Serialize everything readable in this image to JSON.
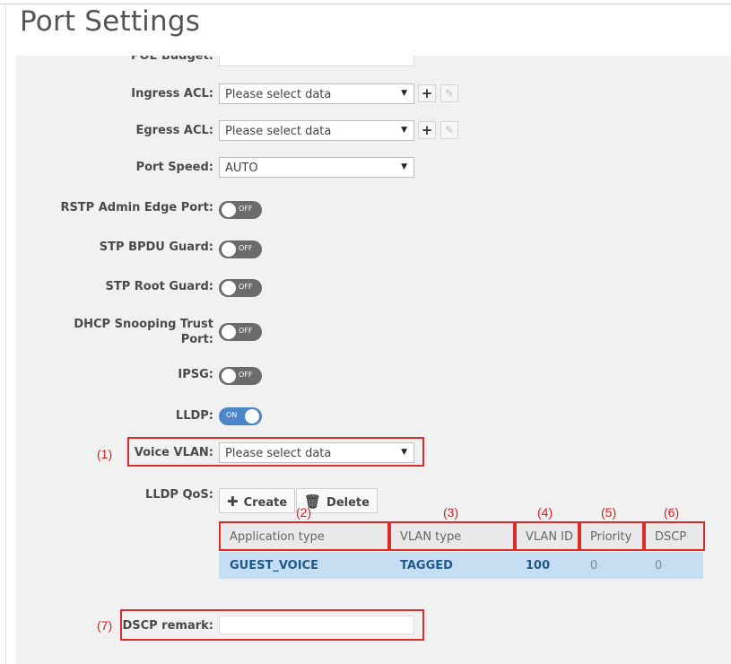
{
  "page": {
    "title": "Port Settings"
  },
  "form": {
    "poe_budget_label": "POE Budget:",
    "ingress_acl": {
      "label": "Ingress ACL:",
      "value": "Please select data",
      "add_icon": "plus-icon",
      "edit_icon": "pencil-icon"
    },
    "egress_acl": {
      "label": "Egress ACL:",
      "value": "Please select data",
      "add_icon": "plus-icon",
      "edit_icon": "pencil-icon"
    },
    "port_speed": {
      "label": "Port Speed:",
      "value": "AUTO"
    },
    "rstp_admin_edge_port": {
      "label": "RSTP Admin Edge Port:",
      "state": "OFF"
    },
    "stp_bpdu_guard": {
      "label": "STP BPDU Guard:",
      "state": "OFF"
    },
    "stp_root_guard": {
      "label": "STP Root Guard:",
      "state": "OFF"
    },
    "dhcp_snooping_trust_port": {
      "label_line1": "DHCP Snooping Trust",
      "label_line2": "Port:",
      "state": "OFF"
    },
    "ipsg": {
      "label": "IPSG:",
      "state": "OFF"
    },
    "lldp": {
      "label": "LLDP:",
      "state": "ON"
    },
    "voice_vlan": {
      "label": "Voice VLAN:",
      "value": "Please select data"
    },
    "lldp_qos": {
      "label": "LLDP QoS:",
      "create_label": "Create",
      "delete_label": "Delete",
      "columns": [
        "Application type",
        "VLAN type",
        "VLAN ID",
        "Priority",
        "DSCP"
      ],
      "rows": [
        {
          "application_type": "GUEST_VOICE",
          "vlan_type": "TAGGED",
          "vlan_id": "100",
          "priority": "0",
          "dscp": "0"
        }
      ]
    },
    "dscp_remark": {
      "label": "DSCP remark:",
      "value": ""
    }
  },
  "annotations": {
    "voice_vlan": "(1)",
    "application_type": "(2)",
    "vlan_type": "(3)",
    "vlan_id": "(4)",
    "priority": "(5)",
    "dscp": "(6)",
    "dscp_remark": "(7)"
  },
  "colors": {
    "panel_bg": "#f1f1f1",
    "toggle_off": "#6b6b6b",
    "toggle_on": "#4a86c8",
    "selected_row": "#c6def2",
    "selected_row_text": "#1f5a8c",
    "annotation_red": "#e02b2b"
  }
}
